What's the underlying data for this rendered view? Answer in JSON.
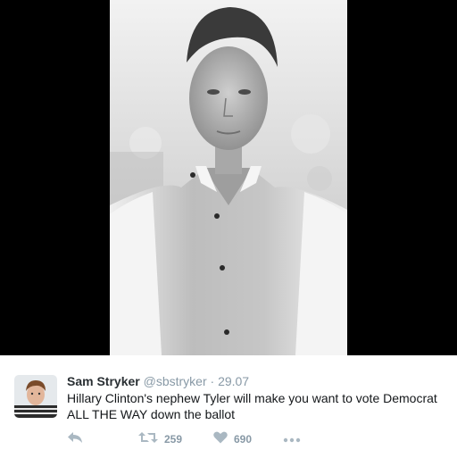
{
  "tweet": {
    "author_name": "Sam Stryker",
    "handle": "@sbstryker",
    "separator": "·",
    "date": "29.07",
    "text": "Hillary Clinton's nephew Tyler will make you want to vote Democrat ALL THE WAY down the ballot",
    "retweet_count": "259",
    "like_count": "690"
  },
  "icons": {
    "reply": "reply-icon",
    "retweet": "retweet-icon",
    "like": "heart-icon",
    "more": "more-icon"
  },
  "colors": {
    "media_background": "#000000",
    "secondary_text": "#8899a6",
    "name_text": "#292f33"
  }
}
